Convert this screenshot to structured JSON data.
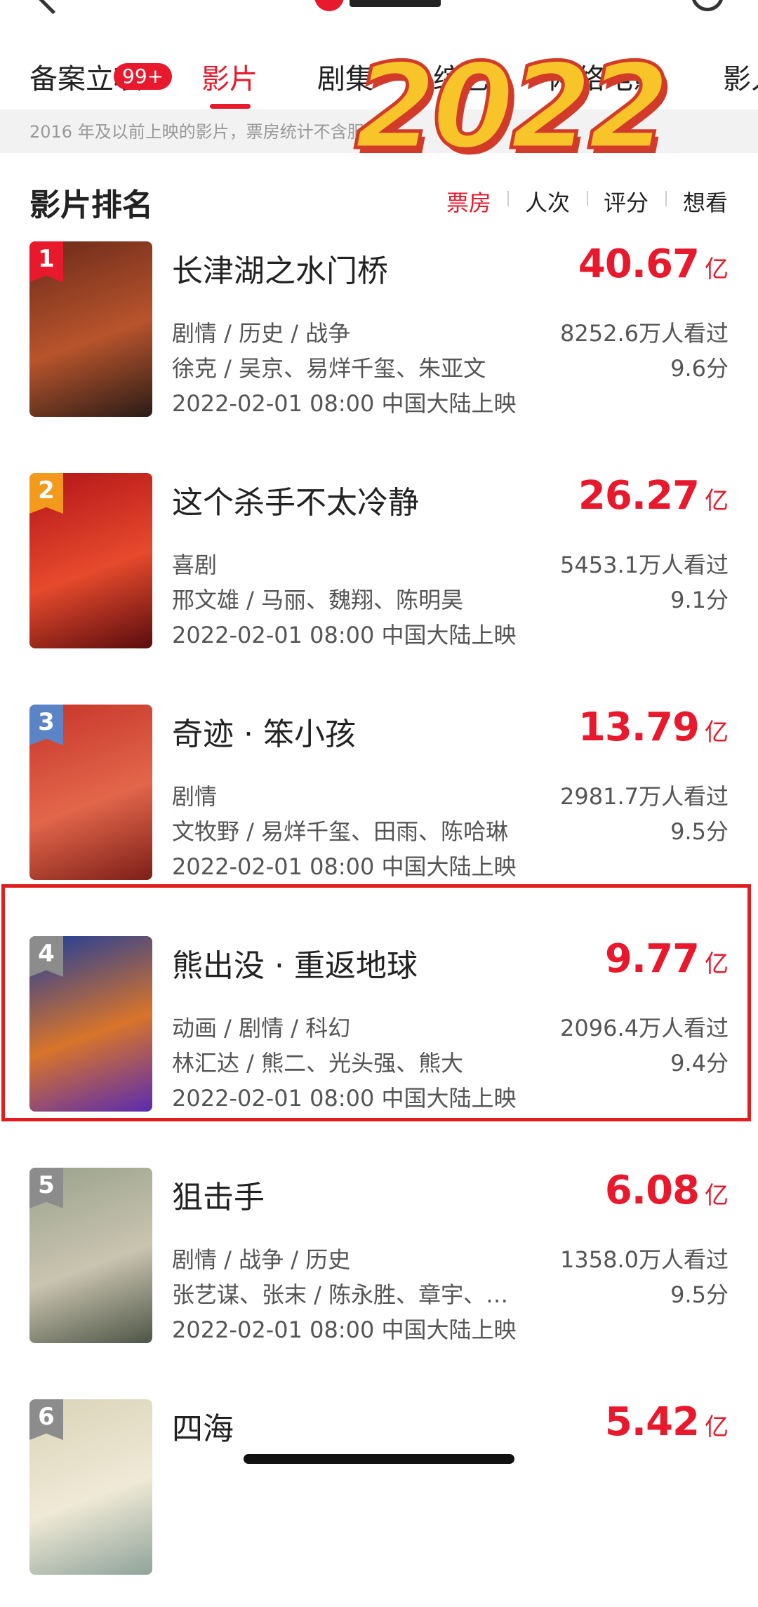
{
  "tabs": [
    {
      "label": "备案立项",
      "active": false
    },
    {
      "label": "影片",
      "active": true
    },
    {
      "label": "剧集",
      "active": false
    },
    {
      "label": "综艺",
      "active": false
    },
    {
      "label": "网络电影",
      "active": false
    },
    {
      "label": "影人",
      "active": false
    }
  ],
  "badge": "99+",
  "notice": "2016 年及以前上映的影片，票房统计不含服务费",
  "overlay_text": "2022",
  "section": {
    "title": "影片排名",
    "sorts": [
      {
        "label": "票房",
        "active": true
      },
      {
        "label": "人次",
        "active": false
      },
      {
        "label": "评分",
        "active": false
      },
      {
        "label": "想看",
        "active": false
      }
    ]
  },
  "movies": [
    {
      "rank": "1",
      "title": "长津湖之水门桥",
      "box_office": "40.67",
      "unit": "亿",
      "genres": "剧情 / 历史 / 战争",
      "people": "徐克 / 吴京、易烊千玺、朱亚文",
      "viewers": "8252.6万人看过",
      "score": "9.6分",
      "release": "2022-02-01 08:00 中国大陆上映",
      "rank_color": "#e8192c",
      "poster_colors": [
        "#6b2a1a",
        "#2a1c16",
        "#b8542c"
      ]
    },
    {
      "rank": "2",
      "title": "这个杀手不太冷静",
      "box_office": "26.27",
      "unit": "亿",
      "genres": "喜剧",
      "people": "邢文雄 / 马丽、魏翔、陈明昊",
      "viewers": "5453.1万人看过",
      "score": "9.1分",
      "release": "2022-02-01 08:00 中国大陆上映",
      "rank_color": "#f39a1c",
      "poster_colors": [
        "#b3141a",
        "#5a0c0e",
        "#e64a2c"
      ]
    },
    {
      "rank": "3",
      "title": "奇迹 · 笨小孩",
      "box_office": "13.79",
      "unit": "亿",
      "genres": "剧情",
      "people": "文牧野 / 易烊千玺、田雨、陈哈琳",
      "viewers": "2981.7万人看过",
      "score": "9.5分",
      "release": "2022-02-01 08:00 中国大陆上映",
      "rank_color": "#5b84c7",
      "poster_colors": [
        "#c7352a",
        "#7d1f18",
        "#e2664a"
      ]
    },
    {
      "rank": "4",
      "title": "熊出没 · 重返地球",
      "box_office": "9.77",
      "unit": "亿",
      "genres": "动画 / 剧情 / 科幻",
      "people": "林汇达 / 熊二、光头强、熊大",
      "viewers": "2096.4万人看过",
      "score": "9.4分",
      "release": "2022-02-01 08:00 中国大陆上映",
      "rank_color": "#8c8c8c",
      "poster_colors": [
        "#1c3d9c",
        "#5a2bb0",
        "#d8742a"
      ]
    },
    {
      "rank": "5",
      "title": "狙击手",
      "box_office": "6.08",
      "unit": "亿",
      "genres": "剧情 / 战争 / 历史",
      "people": "张艺谋、张末 / 陈永胜、章宇、…",
      "viewers": "1358.0万人看过",
      "score": "9.5分",
      "release": "2022-02-01 08:00 中国大陆上映",
      "rank_color": "#8c8c8c",
      "poster_colors": [
        "#9aa28c",
        "#4e5546",
        "#c9c4b0"
      ]
    },
    {
      "rank": "6",
      "title": "四海",
      "box_office": "5.42",
      "unit": "亿",
      "genres": "",
      "people": "",
      "viewers": "",
      "score": "",
      "release": "",
      "rank_color": "#8c8c8c",
      "poster_colors": [
        "#d9d3b8",
        "#8fa39a",
        "#efe9d6"
      ]
    }
  ]
}
